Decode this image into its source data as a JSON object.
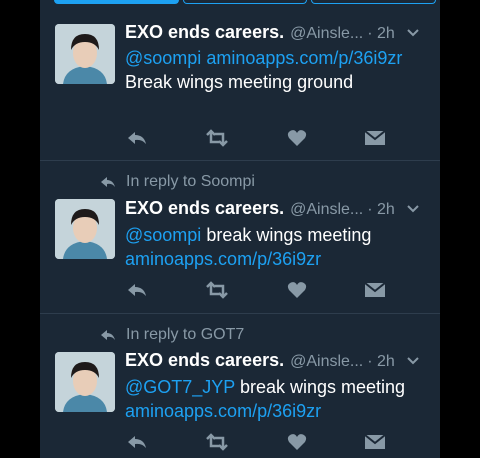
{
  "tweets": [
    {
      "reply_to": "",
      "name": "EXO ends careers.",
      "handle": "@Ainsle...",
      "time": "· 2h",
      "mention": "@soompi",
      "mid_text": " ",
      "link": "aminoapps.com/p/36i9zr",
      "after_text": " Break wings meeting ground"
    },
    {
      "reply_to": "In reply to Soompi",
      "name": "EXO ends careers.",
      "handle": "@Ainsle...",
      "time": "· 2h",
      "mention": "@soompi",
      "mid_text": " break wings meeting ",
      "link": "aminoapps.com/p/36i9zr",
      "after_text": ""
    },
    {
      "reply_to": "In reply to GOT7",
      "name": "EXO ends careers.",
      "handle": "@Ainsle...",
      "time": "· 2h",
      "mention": "@GOT7_JYP",
      "mid_text": " break wings meeting ",
      "link": "aminoapps.com/p/36i9zr",
      "after_text": ""
    }
  ],
  "colors": {
    "background": "#1b2836",
    "accent": "#1da1f2",
    "muted": "#8899a6",
    "text": "#ffffff"
  }
}
